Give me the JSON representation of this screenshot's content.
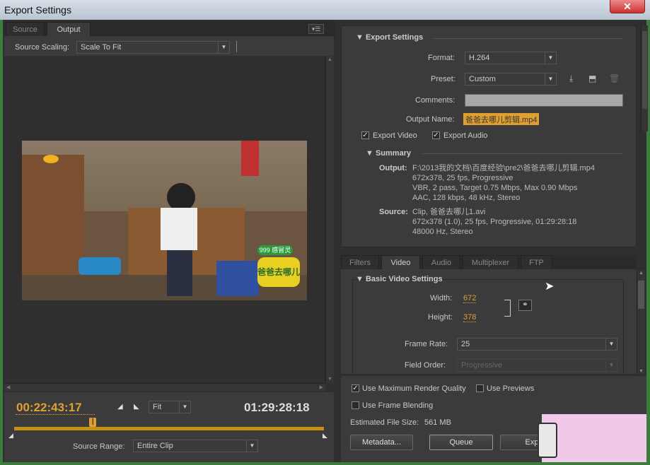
{
  "window": {
    "title": "Export Settings",
    "close_glyph": "✕"
  },
  "left": {
    "tabs": [
      {
        "label": "Source"
      },
      {
        "label": "Output"
      }
    ],
    "scaling_label": "Source Scaling:",
    "scaling_value": "Scale To Fit",
    "timecode_current": "00:22:43:17",
    "timecode_total": "01:29:28:18",
    "zoom_value": "Fit",
    "range_label": "Source Range:",
    "range_value": "Entire Clip",
    "playhead_fraction": 0.254,
    "video_overlay": {
      "badge": "999 感冒灵",
      "logo": "爸爸去哪儿"
    }
  },
  "export": {
    "header": "Export Settings",
    "format_label": "Format:",
    "format_value": "H.264",
    "preset_label": "Preset:",
    "preset_value": "Custom",
    "comments_label": "Comments:",
    "output_name_label": "Output Name:",
    "output_name_value": "爸爸去哪儿剪辑.mp4",
    "export_video": "Export Video",
    "export_audio": "Export Audio",
    "summary_header": "Summary",
    "output_label": "Output:",
    "output_lines": [
      "F:\\2013我的文档\\百度经验\\pre2\\爸爸去哪儿剪辑.mp4",
      "672x378, 25 fps, Progressive",
      "VBR, 2 pass, Target 0.75 Mbps, Max 0.90 Mbps",
      "AAC, 128 kbps, 48 kHz, Stereo"
    ],
    "source_label": "Source:",
    "source_lines": [
      "Clip, 爸爸去哪儿1.avi",
      "672x378 (1.0), 25 fps, Progressive, 01:29:28:18",
      "48000 Hz, Stereo"
    ]
  },
  "settings_tabs": [
    {
      "label": "Filters"
    },
    {
      "label": "Video"
    },
    {
      "label": "Audio"
    },
    {
      "label": "Multiplexer"
    },
    {
      "label": "FTP"
    }
  ],
  "video": {
    "header": "Basic Video Settings",
    "width_label": "Width:",
    "width_value": "672",
    "height_label": "Height:",
    "height_value": "378",
    "frame_rate_label": "Frame Rate:",
    "frame_rate_value": "25",
    "field_order_label": "Field Order:",
    "field_order_value": "Progressive"
  },
  "bottom": {
    "max_render": "Use Maximum Render Quality",
    "use_previews": "Use Previews",
    "frame_blending": "Use Frame Blending",
    "file_size_label": "Estimated File Size:",
    "file_size_value": "561 MB",
    "metadata_btn": "Metadata...",
    "queue_btn": "Queue",
    "export_btn": "Exp"
  },
  "colors": {
    "accent": "#e0a030",
    "panel": "#3b3b3b",
    "dark": "#2f2f2f"
  }
}
